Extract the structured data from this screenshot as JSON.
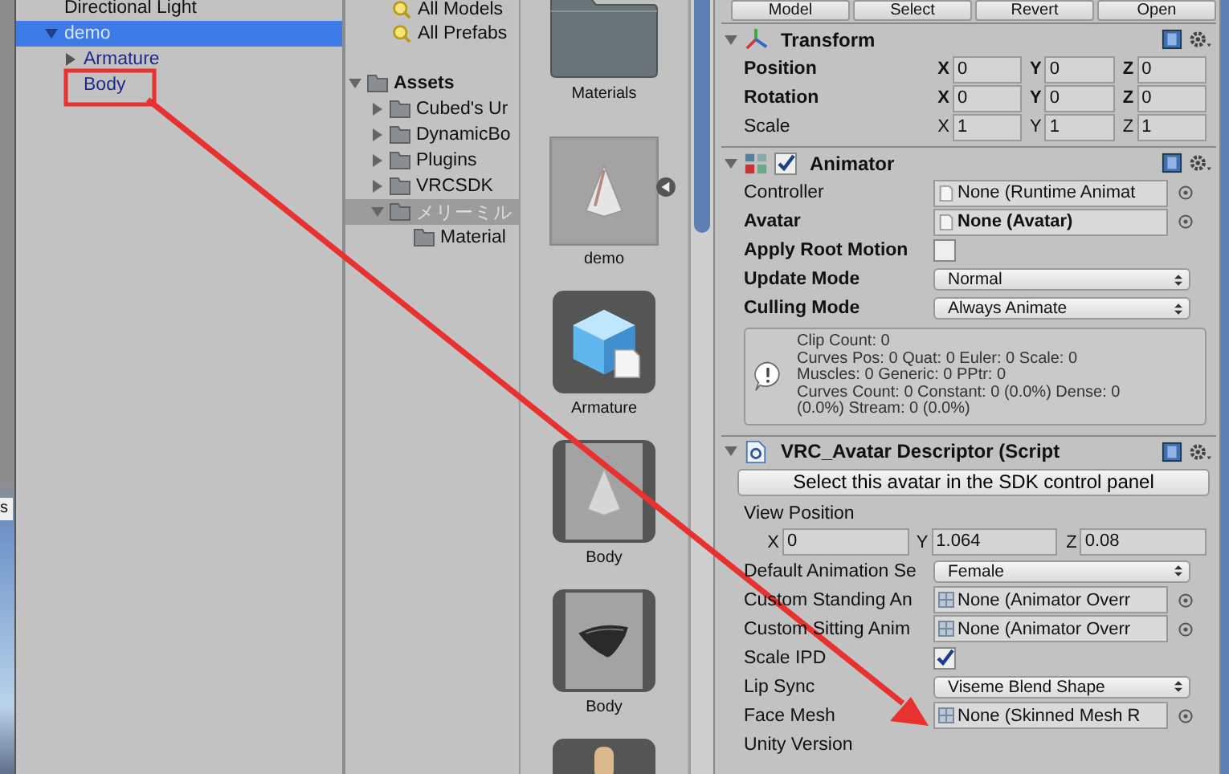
{
  "scene_edge": {
    "text": "s"
  },
  "hierarchy": {
    "items": [
      {
        "label": "Directional Light",
        "selected": false,
        "prefab": false
      },
      {
        "label": "demo",
        "selected": true,
        "prefab": true,
        "expanded": true,
        "children": [
          {
            "label": "Armature",
            "selected": false,
            "prefab": true,
            "expanded": false
          },
          {
            "label": "Body",
            "selected": false,
            "prefab": true
          }
        ]
      }
    ]
  },
  "project": {
    "favorites": [
      "All Models",
      "All Prefabs"
    ],
    "tree": [
      {
        "label": "Assets",
        "bold": true,
        "selected": false,
        "expanded": true,
        "children": [
          {
            "label": "Cubed's Ur",
            "selected": false,
            "expanded": false
          },
          {
            "label": "DynamicBo",
            "selected": false,
            "expanded": false
          },
          {
            "label": "Plugins",
            "selected": false,
            "expanded": false
          },
          {
            "label": "VRCSDK",
            "selected": false,
            "expanded": false
          },
          {
            "label": "メリーミル",
            "selected": true,
            "expanded": true,
            "children": [
              {
                "label": "Material",
                "selected": false
              }
            ]
          }
        ]
      }
    ],
    "assets": [
      {
        "kind": "folder",
        "label": "Materials",
        "selected": false
      },
      {
        "kind": "model",
        "label": "demo",
        "selected": true
      },
      {
        "kind": "prefab",
        "label": "Armature",
        "selected": false
      },
      {
        "kind": "mesh",
        "label": "Body",
        "selected": false
      },
      {
        "kind": "mesh-dark",
        "label": "Body",
        "selected": false
      },
      {
        "kind": "bone",
        "selected": false
      }
    ]
  },
  "inspector": {
    "header_buttons": [
      "Model",
      "Select",
      "Revert",
      "Open"
    ],
    "transform": {
      "title": "Transform",
      "rows": [
        {
          "label": "Position",
          "modified": true,
          "vector": [
            {
              "axis": "X",
              "value": "0"
            },
            {
              "axis": "Y",
              "value": "0"
            },
            {
              "axis": "Z",
              "value": "0"
            }
          ]
        },
        {
          "label": "Rotation",
          "modified": true,
          "vector": [
            {
              "axis": "X",
              "value": "0"
            },
            {
              "axis": "Y",
              "value": "0"
            },
            {
              "axis": "Z",
              "value": "0"
            }
          ]
        },
        {
          "label": "Scale",
          "modified": false,
          "vector": [
            {
              "axis": "X",
              "value": "1"
            },
            {
              "axis": "Y",
              "value": "1"
            },
            {
              "axis": "Z",
              "value": "1"
            }
          ]
        }
      ]
    },
    "animator": {
      "title": "Animator",
      "enabled": true,
      "rows": [
        {
          "kind": "object",
          "label": "Controller",
          "value": "None (Runtime Animat",
          "modified": false
        },
        {
          "kind": "object",
          "label": "Avatar",
          "value": "None (Avatar)",
          "modified": true
        },
        {
          "kind": "checkbox",
          "label": "Apply Root Motion",
          "checked": false,
          "modified": true
        },
        {
          "kind": "dropdown",
          "label": "Update Mode",
          "value": "Normal",
          "modified": true
        },
        {
          "kind": "dropdown",
          "label": "Culling Mode",
          "value": "Always Animate",
          "modified": true
        }
      ],
      "info": [
        "Clip Count: 0",
        "Curves Pos: 0 Quat: 0 Euler: 0 Scale: 0",
        "Muscles: 0 Generic: 0 PPtr: 0",
        "Curves Count: 0 Constant: 0 (0.0%) Dense: 0",
        "(0.0%) Stream: 0 (0.0%)"
      ]
    },
    "descriptor": {
      "title": "VRC_Avatar Descriptor (Script",
      "button": "Select this avatar in the SDK control panel",
      "rows": [
        {
          "kind": "label",
          "label": "View Position"
        },
        {
          "kind": "vector",
          "vector": [
            {
              "axis": "X",
              "value": "0"
            },
            {
              "axis": "Y",
              "value": "1.064"
            },
            {
              "axis": "Z",
              "value": "0.08"
            }
          ]
        },
        {
          "kind": "dropdown",
          "label": "Default Animation Se",
          "value": "Female",
          "modified": false
        },
        {
          "kind": "object",
          "label": "Custom Standing An",
          "value": "None (Animator Overr",
          "modified": false
        },
        {
          "kind": "object",
          "label": "Custom Sitting Anim",
          "value": "None (Animator Overr",
          "modified": false
        },
        {
          "kind": "checkbox",
          "label": "Scale IPD",
          "checked": true,
          "modified": false
        },
        {
          "kind": "dropdown",
          "label": "Lip Sync",
          "value": "Viseme Blend Shape",
          "modified": false
        },
        {
          "kind": "object",
          "label": "Face Mesh",
          "value": "None (Skinned Mesh R",
          "modified": false
        },
        {
          "kind": "label",
          "label": "Unity Version"
        }
      ]
    }
  }
}
